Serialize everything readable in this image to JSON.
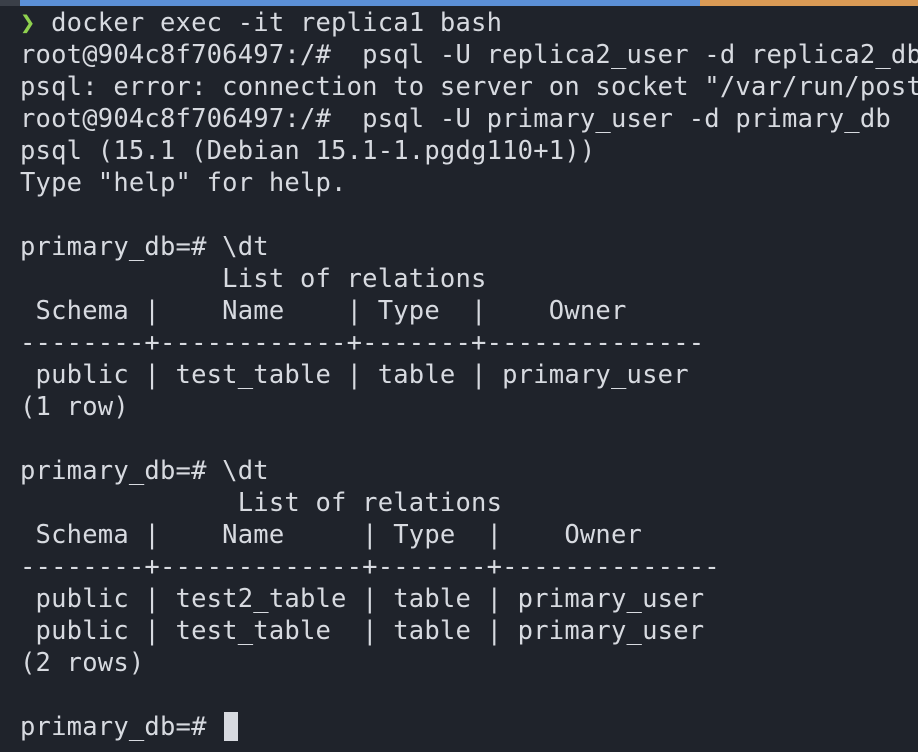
{
  "colors": {
    "background": "#1f232b",
    "text": "#d7dae0",
    "prompt_arrow": "#8fd14f",
    "top_strip_blue": "#5b8fd6",
    "top_strip_orange": "#d99a55"
  },
  "terminal": {
    "first_line": {
      "arrow": "❯",
      "command": " docker exec -it replica1 bash"
    },
    "lines": [
      "root@904c8f706497:/#  psql -U replica2_user -d replica2_db",
      "psql: error: connection to server on socket \"/var/run/postgr",
      "root@904c8f706497:/#  psql -U primary_user -d primary_db",
      "psql (15.1 (Debian 15.1-1.pgdg110+1))",
      "Type \"help\" for help.",
      "",
      "primary_db=# \\dt",
      "             List of relations",
      " Schema |    Name    | Type  |    Owner",
      "--------+------------+-------+--------------",
      " public | test_table | table | primary_user",
      "(1 row)",
      "",
      "primary_db=# \\dt",
      "              List of relations",
      " Schema |    Name     | Type  |    Owner",
      "--------+-------------+-------+--------------",
      " public | test2_table | table | primary_user",
      " public | test_table  | table | primary_user",
      "(2 rows)",
      ""
    ],
    "final_prompt": "primary_db=# "
  }
}
